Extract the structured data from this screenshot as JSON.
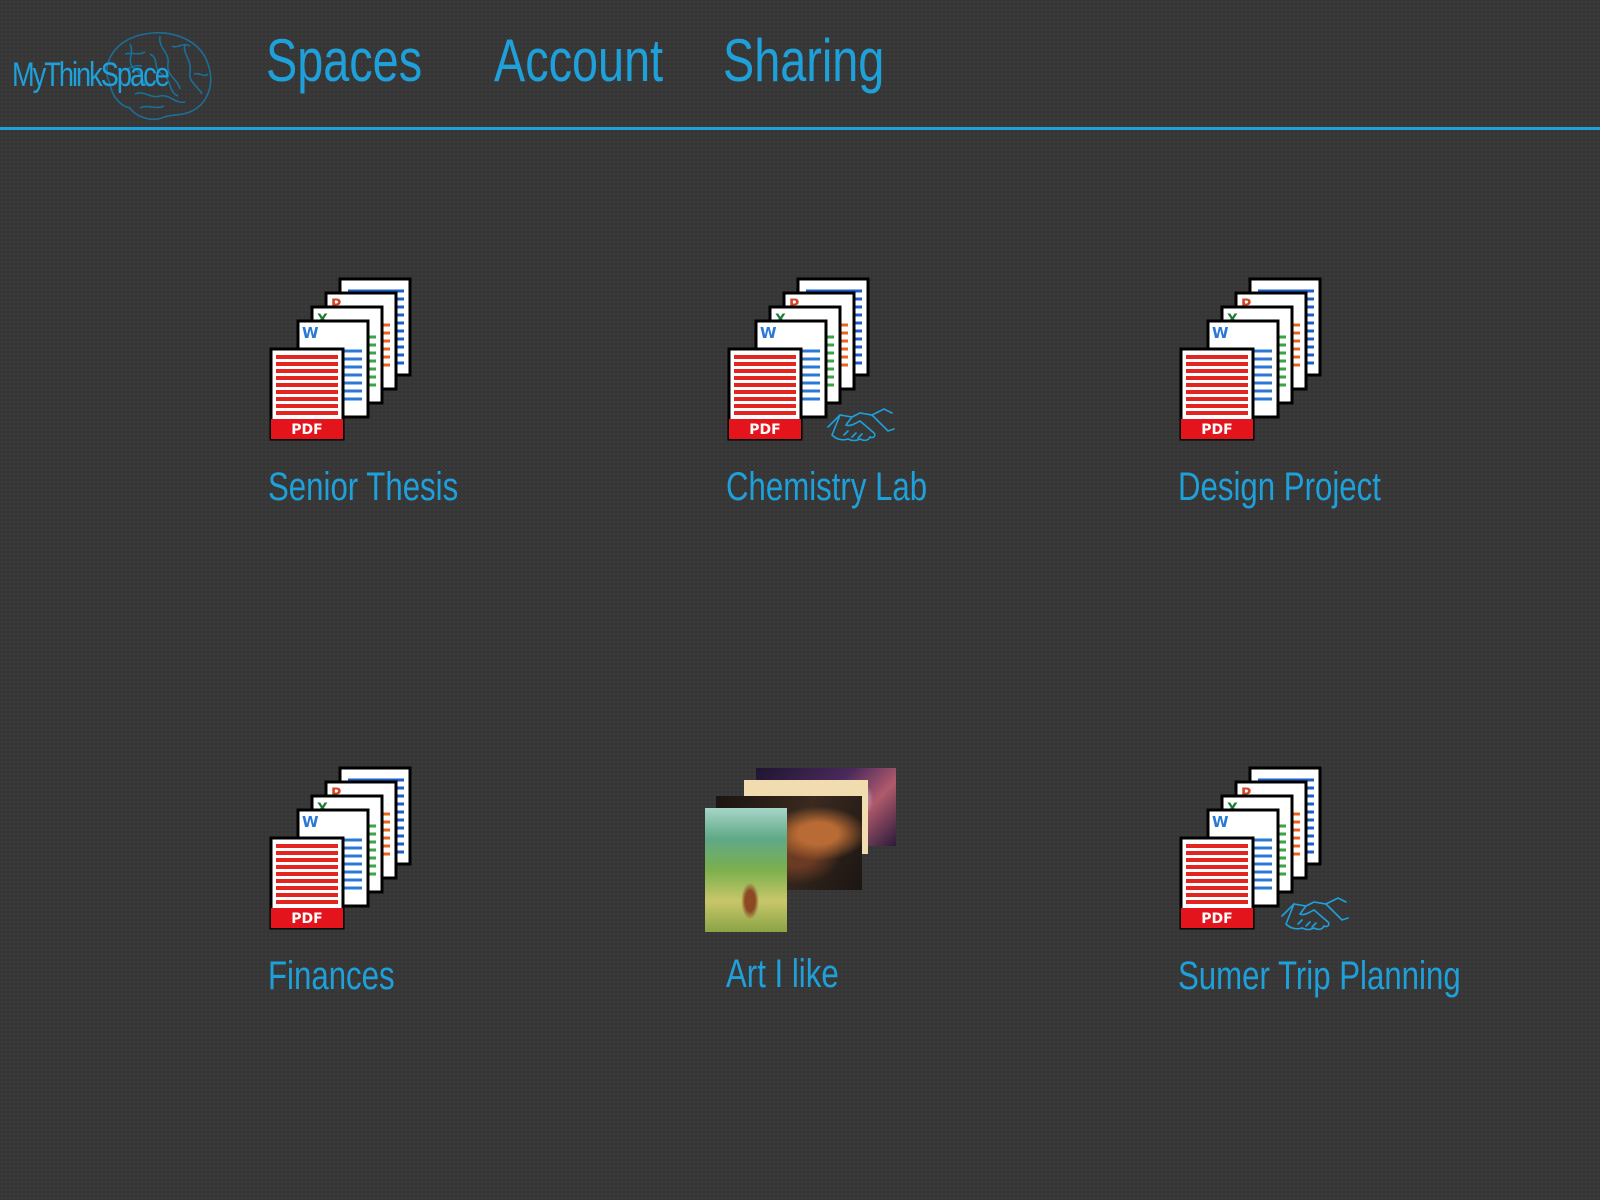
{
  "app": {
    "logo_text": "MyThinkSpace",
    "accent_color": "#1ea0da",
    "background_color": "#363636"
  },
  "nav": {
    "items": [
      {
        "label": "Spaces"
      },
      {
        "label": "Account"
      },
      {
        "label": "Sharing"
      }
    ]
  },
  "spaces": [
    {
      "label": "Senior Thesis",
      "icon": "document-stack-icon",
      "shared": false
    },
    {
      "label": "Chemistry Lab",
      "icon": "document-stack-icon",
      "shared": true
    },
    {
      "label": "Design Project",
      "icon": "document-stack-icon",
      "shared": false
    },
    {
      "label": "Finances",
      "icon": "document-stack-icon",
      "shared": false
    },
    {
      "label": "Art I like",
      "icon": "image-stack-icon",
      "shared": false
    },
    {
      "label": "Sumer Trip Planning",
      "icon": "document-stack-icon",
      "shared": true
    }
  ],
  "doc_icon": {
    "pdf_label": "PDF",
    "word_letter": "W",
    "excel_letter": "X",
    "ppt_letter": "P"
  }
}
